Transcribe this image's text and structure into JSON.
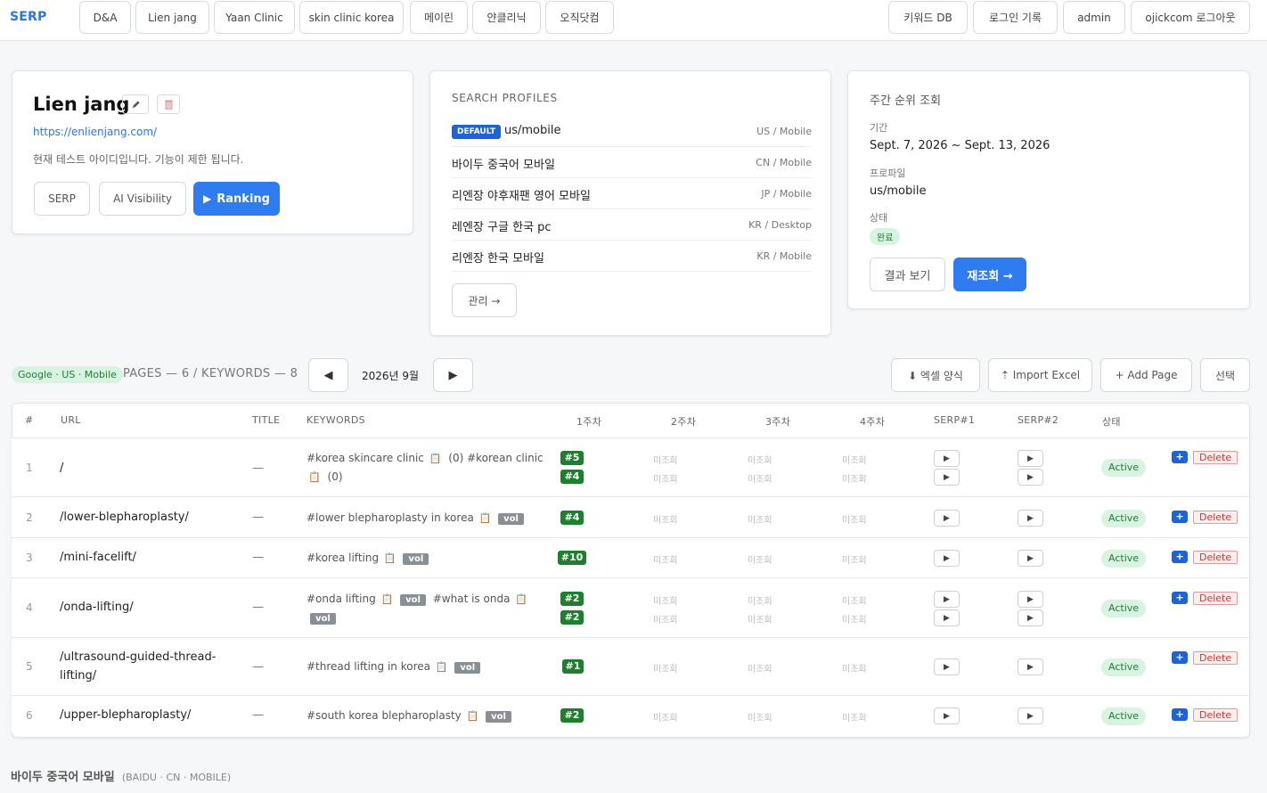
{
  "nav": {
    "brand": "SERP",
    "left_tabs": [
      "D&A",
      "Lien jang",
      "Yaan Clinic",
      "skin clinic korea",
      "메이린",
      "얀클리닉",
      "오직닷컴"
    ],
    "right_tabs": [
      "키워드 DB",
      "로그인 기록",
      "admin",
      "ojickcom 로그아웃"
    ]
  },
  "site": {
    "name": "Lien jang",
    "url": "https://enlienjang.com/",
    "notice": "현재 테스트 아이디입니다. 기능이 제한 됩니다.",
    "edit_icon": "pencil-icon",
    "delete_icon": "trash-icon",
    "buttons": {
      "serp": "SERP",
      "ai": "AI Visibility",
      "ranking": "Ranking"
    }
  },
  "profiles": {
    "heading": "SEARCH PROFILES",
    "default_badge": "DEFAULT",
    "items": [
      {
        "name": "us/mobile",
        "meta": "US / Mobile"
      },
      {
        "name": "바이두 중국어 모바일",
        "meta": "CN / Mobile"
      },
      {
        "name": "리엔장 야후재팬 영어 모바일",
        "meta": "JP / Mobile"
      },
      {
        "name": "레엔장 구글 한국 pc",
        "meta": "KR / Desktop"
      },
      {
        "name": "리엔장 한국 모바일",
        "meta": "KR / Mobile"
      }
    ],
    "manage": "관리 →"
  },
  "weekly": {
    "heading": "주간 순위 조회",
    "period_label": "기간",
    "period": "Sept. 7, 2026 ~ Sept. 13, 2026",
    "profile_label": "프로파일",
    "profile": "us/mobile",
    "status_label": "상태",
    "status": "완료",
    "view_btn": "결과 보기",
    "requery_btn": "재조회 →"
  },
  "toolbar": {
    "badge": "Google · US · Mobile",
    "summary": "PAGES — 6 / KEYWORDS — 8",
    "month": "2026년 9월",
    "prev": "◀",
    "next": "▶",
    "excel_form": "⬇ 엑셀 양식",
    "import_excel": "⇡ Import Excel",
    "add_page": "+ Add Page",
    "select": "선택"
  },
  "table": {
    "headers": [
      "#",
      "URL",
      "TITLE",
      "KEYWORDS",
      "1주차",
      "2주차",
      "3주차",
      "4주차",
      "SERP#1",
      "SERP#2",
      "상태"
    ],
    "unqueried": "미조회",
    "active": "Active",
    "delete": "Delete",
    "plus": "+",
    "dash": "—",
    "vol": "vol",
    "rows": [
      {
        "num": "1",
        "url": "/",
        "kw_line1": "#korea skincare clinic",
        "kw_line1_count": "(0)",
        "kw_line1_b": "#korean clinic",
        "kw_line2_count": "(0)",
        "ranks": [
          "#5",
          "#4"
        ]
      },
      {
        "num": "2",
        "url": "/lower-blepharoplasty/",
        "kw_line1": "#lower blepharoplasty in korea",
        "ranks": [
          "#4"
        ]
      },
      {
        "num": "3",
        "url": "/mini-facelift/",
        "kw_line1": "#korea lifting",
        "ranks": [
          "#10"
        ]
      },
      {
        "num": "4",
        "url": "/onda-lifting/",
        "kw_line1": "#onda lifting",
        "kw_line1_b": "#what is onda",
        "ranks": [
          "#2",
          "#2"
        ]
      },
      {
        "num": "5",
        "url_line1": "/ultrasound-guided-thread-",
        "url_line2": "lifting/",
        "kw_line1": "#thread lifting in korea",
        "ranks": [
          "#1"
        ]
      },
      {
        "num": "6",
        "url": "/upper-blepharoplasty/",
        "kw_line1": "#south korea blepharoplasty",
        "ranks": [
          "#2"
        ]
      }
    ]
  },
  "next_section": {
    "title": "바이두 중국어 모바일",
    "sub": "(BAIDU · CN · MOBILE)"
  }
}
